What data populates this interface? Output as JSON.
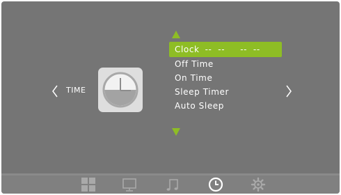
{
  "section": {
    "label": "TIME"
  },
  "menu": {
    "items": [
      {
        "label": "Clock",
        "value": "--  --     --  --",
        "selected": true
      },
      {
        "label": "Off Time",
        "value": "",
        "selected": false
      },
      {
        "label": "On Time",
        "value": "",
        "selected": false
      },
      {
        "label": "Sleep Timer",
        "value": "",
        "selected": false
      },
      {
        "label": "Auto Sleep",
        "value": "",
        "selected": false
      }
    ]
  },
  "tabs": [
    {
      "name": "picture",
      "icon": "grid-icon",
      "active": false
    },
    {
      "name": "screen",
      "icon": "monitor-icon",
      "active": false
    },
    {
      "name": "sound",
      "icon": "music-note-icon",
      "active": false
    },
    {
      "name": "time",
      "icon": "clock-icon",
      "active": true
    },
    {
      "name": "setup",
      "icon": "gear-icon",
      "active": false
    }
  ],
  "colors": {
    "background": "#757575",
    "accent": "#8ebd25",
    "text": "#ffffff",
    "bottom_bar": "#808080",
    "inactive_icon": "#a9a9a9"
  }
}
